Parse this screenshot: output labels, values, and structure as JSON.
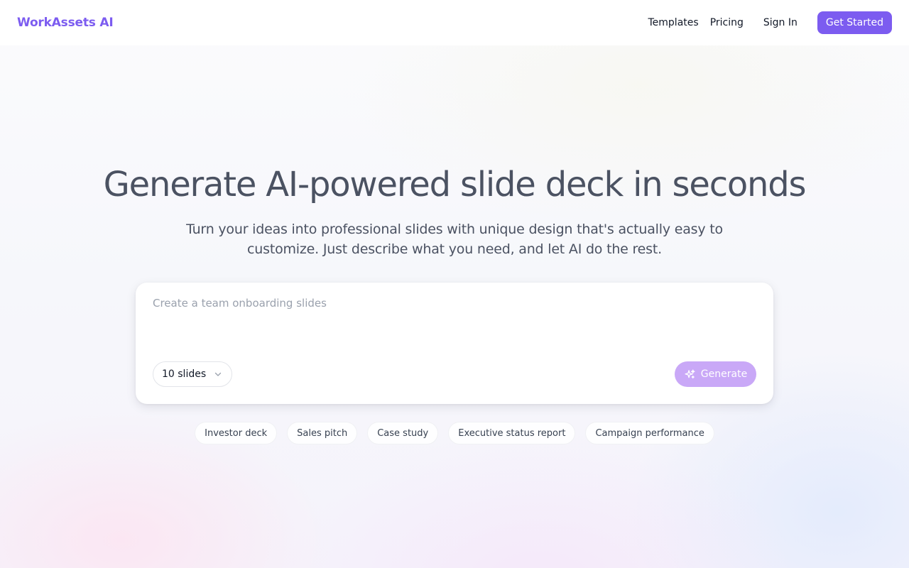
{
  "header": {
    "logo": "WorkAssets AI",
    "nav": {
      "templates": "Templates",
      "pricing": "Pricing",
      "sign_in": "Sign In",
      "get_started": "Get Started"
    }
  },
  "hero": {
    "title": "Generate AI-powered slide deck in seconds",
    "subtitle": "Turn your ideas into professional slides with unique design that's actually easy to customize. Just describe what you need, and let AI do the rest."
  },
  "prompt": {
    "placeholder": "Create a team onboarding slides",
    "value": "",
    "slide_count": "10 slides",
    "generate_label": "Generate"
  },
  "suggestions": [
    "Investor deck",
    "Sales pitch",
    "Case study",
    "Executive status report",
    "Campaign performance"
  ],
  "colors": {
    "brand": "#7c5cf0",
    "generate_disabled": "#c9a8f7",
    "heading_text": "#4b5262"
  },
  "icons": {
    "chevron": "chevron-down-icon",
    "sparkle": "sparkles-icon"
  }
}
